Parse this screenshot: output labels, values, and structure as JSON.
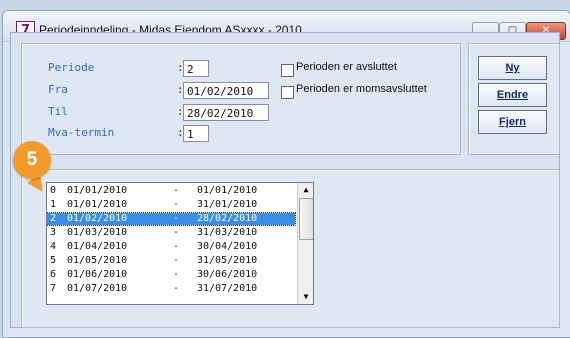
{
  "window": {
    "title": "Periodeinndeling - Midas Eiendom ASxxxx - 2010",
    "icon": "7"
  },
  "form": {
    "periode_label": "Periode",
    "periode_value": "2",
    "fra_label": "Fra",
    "fra_value": "01/02/2010",
    "til_label": "Til",
    "til_value": "28/02/2010",
    "mva_label": "Mva-termin",
    "mva_value": "1",
    "colon": ":",
    "checkbox1": "Perioden er avsluttet",
    "checkbox2": "Perioden er momsavsluttet"
  },
  "buttons": {
    "ny": "Ny",
    "endre": "Endre",
    "fjern": "Fjern"
  },
  "badge": "5",
  "list": {
    "rows": [
      {
        "num": "0",
        "from": "01/01/2010",
        "dash": "-",
        "to": "01/01/2010"
      },
      {
        "num": "1",
        "from": "01/01/2010",
        "dash": "-",
        "to": "31/01/2010"
      },
      {
        "num": "2",
        "from": "01/02/2010",
        "dash": "-",
        "to": "28/02/2010"
      },
      {
        "num": "3",
        "from": "01/03/2010",
        "dash": "-",
        "to": "31/03/2010"
      },
      {
        "num": "4",
        "from": "01/04/2010",
        "dash": "-",
        "to": "30/04/2010"
      },
      {
        "num": "5",
        "from": "01/05/2010",
        "dash": "-",
        "to": "31/05/2010"
      },
      {
        "num": "6",
        "from": "01/06/2010",
        "dash": "-",
        "to": "30/06/2010"
      },
      {
        "num": "7",
        "from": "01/07/2010",
        "dash": "-",
        "to": "31/07/2010"
      }
    ]
  }
}
